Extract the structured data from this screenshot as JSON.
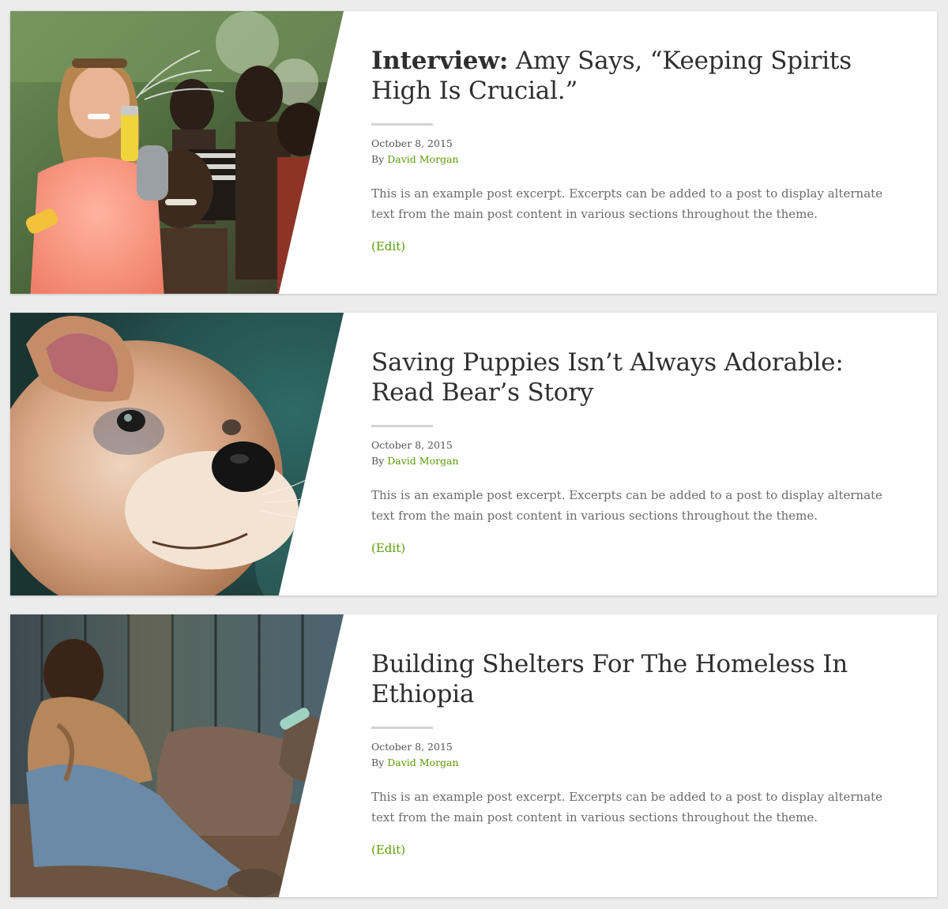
{
  "posts": [
    {
      "image_alt": "Woman spraying silly string with children",
      "title_strong": "Interview:",
      "title_rest": " Amy Says, “Keeping Spirits High Is Crucial.”",
      "date": "October 8, 2015",
      "by_label": "By",
      "author": "David Morgan",
      "excerpt": "This is an example post excerpt. Excerpts can be added to a post to display alternate text from the main post content in various sections throughout the theme.",
      "edit_label": "(Edit)"
    },
    {
      "image_alt": "Close-up of a dog",
      "title_strong": "",
      "title_rest": "Saving Puppies Isn’t Always Adorable: Read Bear’s Story",
      "date": "October 8, 2015",
      "by_label": "By",
      "author": "David Morgan",
      "excerpt": "This is an example post excerpt. Excerpts can be added to a post to display alternate text from the main post content in various sections throughout the theme.",
      "edit_label": "(Edit)"
    },
    {
      "image_alt": "Man resting against a wooden wall",
      "title_strong": "",
      "title_rest": "Building Shelters For The Homeless In Ethiopia",
      "date": "October 8, 2015",
      "by_label": "By",
      "author": "David Morgan",
      "excerpt": "This is an example post excerpt. Excerpts can be added to a post to display alternate text from the main post content in various sections throughout the theme.",
      "edit_label": "(Edit)"
    }
  ],
  "colors": {
    "page_bg": "#ececec",
    "card_bg": "#ffffff",
    "title": "#2f2f2f",
    "accent_link": "#5a9a07",
    "excerpt": "#6b6b6b"
  }
}
